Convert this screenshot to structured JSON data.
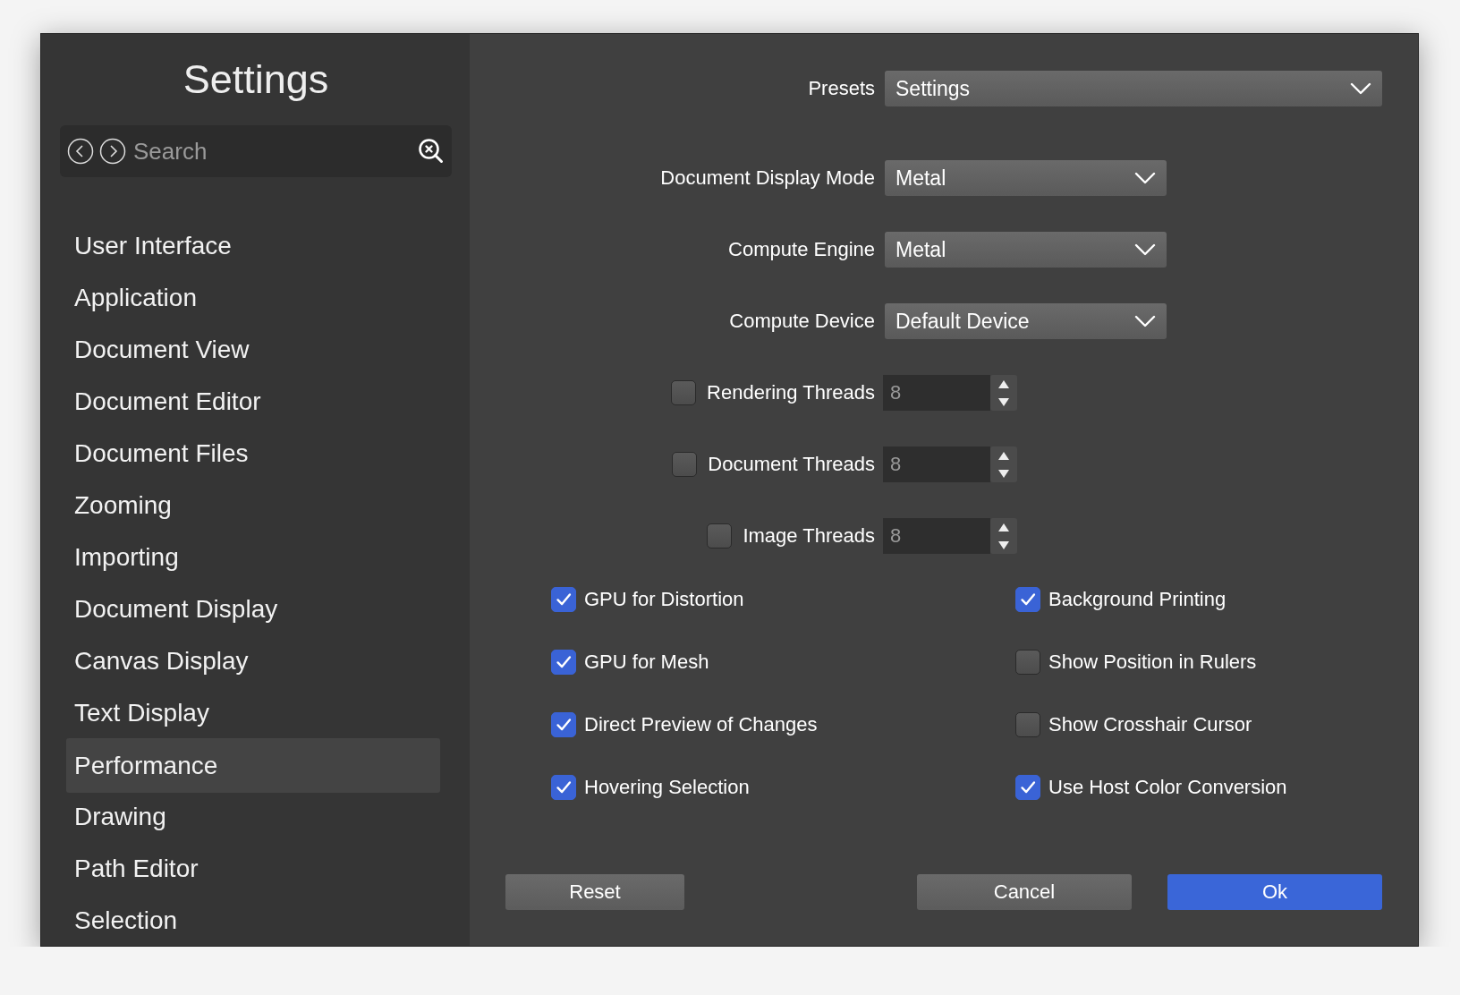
{
  "sidebar": {
    "title": "Settings",
    "search": {
      "placeholder": "Search"
    },
    "items": [
      {
        "label": "User Interface",
        "selected": false
      },
      {
        "label": "Application",
        "selected": false
      },
      {
        "label": "Document View",
        "selected": false
      },
      {
        "label": "Document Editor",
        "selected": false
      },
      {
        "label": "Document Files",
        "selected": false
      },
      {
        "label": "Zooming",
        "selected": false
      },
      {
        "label": "Importing",
        "selected": false
      },
      {
        "label": "Document Display",
        "selected": false
      },
      {
        "label": "Canvas Display",
        "selected": false
      },
      {
        "label": "Text Display",
        "selected": false
      },
      {
        "label": "Performance",
        "selected": true
      },
      {
        "label": "Drawing",
        "selected": false
      },
      {
        "label": "Path Editor",
        "selected": false
      },
      {
        "label": "Selection",
        "selected": false
      }
    ]
  },
  "presets": {
    "label": "Presets",
    "value": "Settings"
  },
  "fields": [
    {
      "kind": "dropdown",
      "label": "Document Display Mode",
      "value": "Metal"
    },
    {
      "kind": "dropdown",
      "label": "Compute Engine",
      "value": "Metal"
    },
    {
      "kind": "dropdown",
      "label": "Compute Device",
      "value": "Default Device"
    },
    {
      "kind": "spinner",
      "label": "Rendering Threads",
      "value": "8",
      "checked": false
    },
    {
      "kind": "spinner",
      "label": "Document Threads",
      "value": "8",
      "checked": false
    },
    {
      "kind": "spinner",
      "label": "Image Threads",
      "value": "8",
      "checked": false
    }
  ],
  "options": [
    {
      "label": "GPU for Distortion",
      "checked": true
    },
    {
      "label": "Background Printing",
      "checked": true
    },
    {
      "label": "GPU for Mesh",
      "checked": true
    },
    {
      "label": "Show Position in Rulers",
      "checked": false
    },
    {
      "label": "Direct Preview of Changes",
      "checked": true
    },
    {
      "label": "Show Crosshair Cursor",
      "checked": false
    },
    {
      "label": "Hovering Selection",
      "checked": true
    },
    {
      "label": "Use Host Color Conversion",
      "checked": true
    }
  ],
  "buttons": [
    {
      "kind": "plain",
      "label": "Reset"
    },
    {
      "kind": "plain",
      "label": "Cancel"
    },
    {
      "kind": "primary",
      "label": "Ok"
    }
  ]
}
